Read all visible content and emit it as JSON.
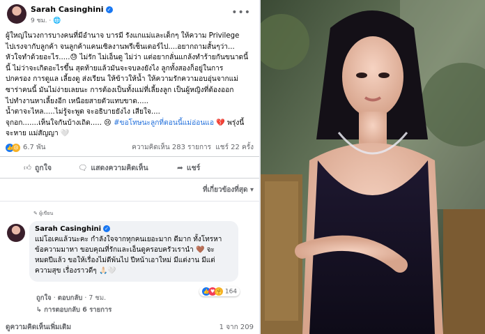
{
  "post": {
    "author": "Sarah Casinghini",
    "time": "9 ชม.",
    "lines": [
      "ผู้ใหญ่ในวงการบางคนที่มีอำนาจ บารมี รังแกแม่และเด็กๆ ให้ความ Privilege",
      "ไปเรงจากับลูกค้า จนลูกค้าแคนเซิลงานพรีเซ็นเตอร์ไป....อยากถามสั้นๆว่า...",
      "หัวใจทำด้วยอะไร.....😓 ไม่รัก ไม่เอ็นดู ไม่ว่า แต่อยากลั่นแกล้งทำร้ายกันขนาดนี้",
      "นี้ ไม่ว่าจะเกิดอะไรขึ้น สุดท้ายแล้วมันจะจบลงยังไง ลูกทั้งสองก็อยู่ในการ",
      "ปกครอง การดูแล เลี้ยงดู ส่งเรียน ให้ข้าวให้น้ำ ให้ความรักความอบอุ่นจากแม่",
      "ซาร่าคนนี้ มันไม่ง่ายเลยนะ การต้องเป็นทั้งแม่ที่เลี้ยงลูก เป็นผู้หญิงที่ต้องออก",
      "ไปทำงานหาเลี้ยงอีก เหนือยสายตัวแทบขาด.....",
      "น้ำตาจะไหล.....ไม่รู้จะพูด จะอธิบายยังไง เสียใจ....",
      "จุกอก.......เห็นใจกันบ้างเถิด..... 😢"
    ],
    "hashtag": "#ขอโทษนะลูกที่ตอนนี้แม่อ่อนแอ",
    "after_hashtag": "💔 พรุ่งนี้",
    "last_line": "จะหาย แม่สัญญา 🤍",
    "reaction_count": "6.7 พัน",
    "comment_count": "ความคิดเห็น 283 รายการ",
    "share_count": "แชร์ 22 ครั้ง"
  },
  "actions": {
    "like": "ถูกใจ",
    "comment": "แสดงความคิดเห็น",
    "share": "แชร์"
  },
  "sort_label": "ที่เกี่ยวข้องที่สุด",
  "comment": {
    "badge": "✎ ผู้เขียน",
    "author": "Sarah Casinghini",
    "lines": [
      "แม่โอเคแล้วนะคะ กำลังใจจากทุกคนเยอะมาก ดีมาก ทั้งโทรหา",
      "ข้อความมาหา ขอบคุณที่รักและเอ็นดูครอบครัวเรานำ 🤎 จะ",
      "หมดปีแล้ว ขอให้เรื่องไม่ดีพ้นไป ปีหน้าเอาใหม่ มีแต่งาน มีแต่",
      "ความสุข เรื่องราวดีๆ 🙏🏻🤍"
    ],
    "reaction_count": "164",
    "like": "ถูกใจ",
    "reply": "ตอบกลับ",
    "time": "7 ชม.",
    "replies": "↳ การตอบกลับ 6 รายการ"
  },
  "footer": {
    "more": "ดูความคิดเห็นเพิ่มเติม",
    "pager": "1 จาก 209"
  },
  "icons": {
    "like": "thumbs-up-icon",
    "comment": "speech-bubble-icon",
    "share": "share-arrow-icon",
    "more": "ellipsis-icon",
    "verified": "verified-badge-icon"
  },
  "colors": {
    "verified": "#1877f2",
    "hashtag": "#216fdb",
    "secondary_text": "#65676b",
    "comment_bubble": "#f0f2f5"
  }
}
